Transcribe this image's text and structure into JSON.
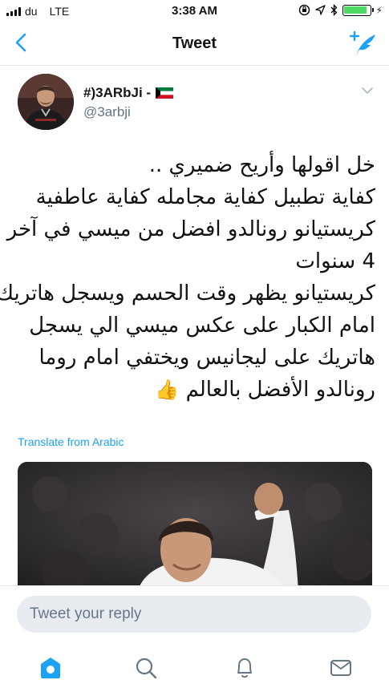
{
  "status_bar": {
    "carrier": "du",
    "network": "LTE",
    "time": "3:38 AM",
    "battery_level": 0.9,
    "charging_symbol": "⚡"
  },
  "nav": {
    "title": "Tweet",
    "back_icon": "chevron-left-icon",
    "compose_icon": "compose-tweet-icon"
  },
  "tweet": {
    "display_name": "#)3ARbJi -",
    "handle": "@3arbji",
    "flag": "kuwait-flag",
    "lines": [
      "خل اقولها وأريح ضميري ..",
      "كفاية تطبيل كفاية مجامله كفاية عاطفية",
      "كريستيانو رونالدو افضل من ميسي في آخر",
      "4 سنوات",
      "كريستيانو يظهر وقت الحسم ويسجل هاتريك",
      "امام الكبار على عكس ميسي الي يسجل",
      "هاتريك على ليجانيس ويختفي امام روما",
      "رونالدو الأفضل بالعالم"
    ],
    "emoji": "👍",
    "translate_label": "Translate from Arabic"
  },
  "reply": {
    "placeholder": "Tweet your reply"
  },
  "tabs": [
    "home-icon",
    "search-icon",
    "notifications-icon",
    "messages-icon"
  ],
  "colors": {
    "accent": "#1da1f2",
    "text_secondary": "#657786",
    "battery": "#4cd964",
    "reply_bg": "#e8ecf0"
  }
}
